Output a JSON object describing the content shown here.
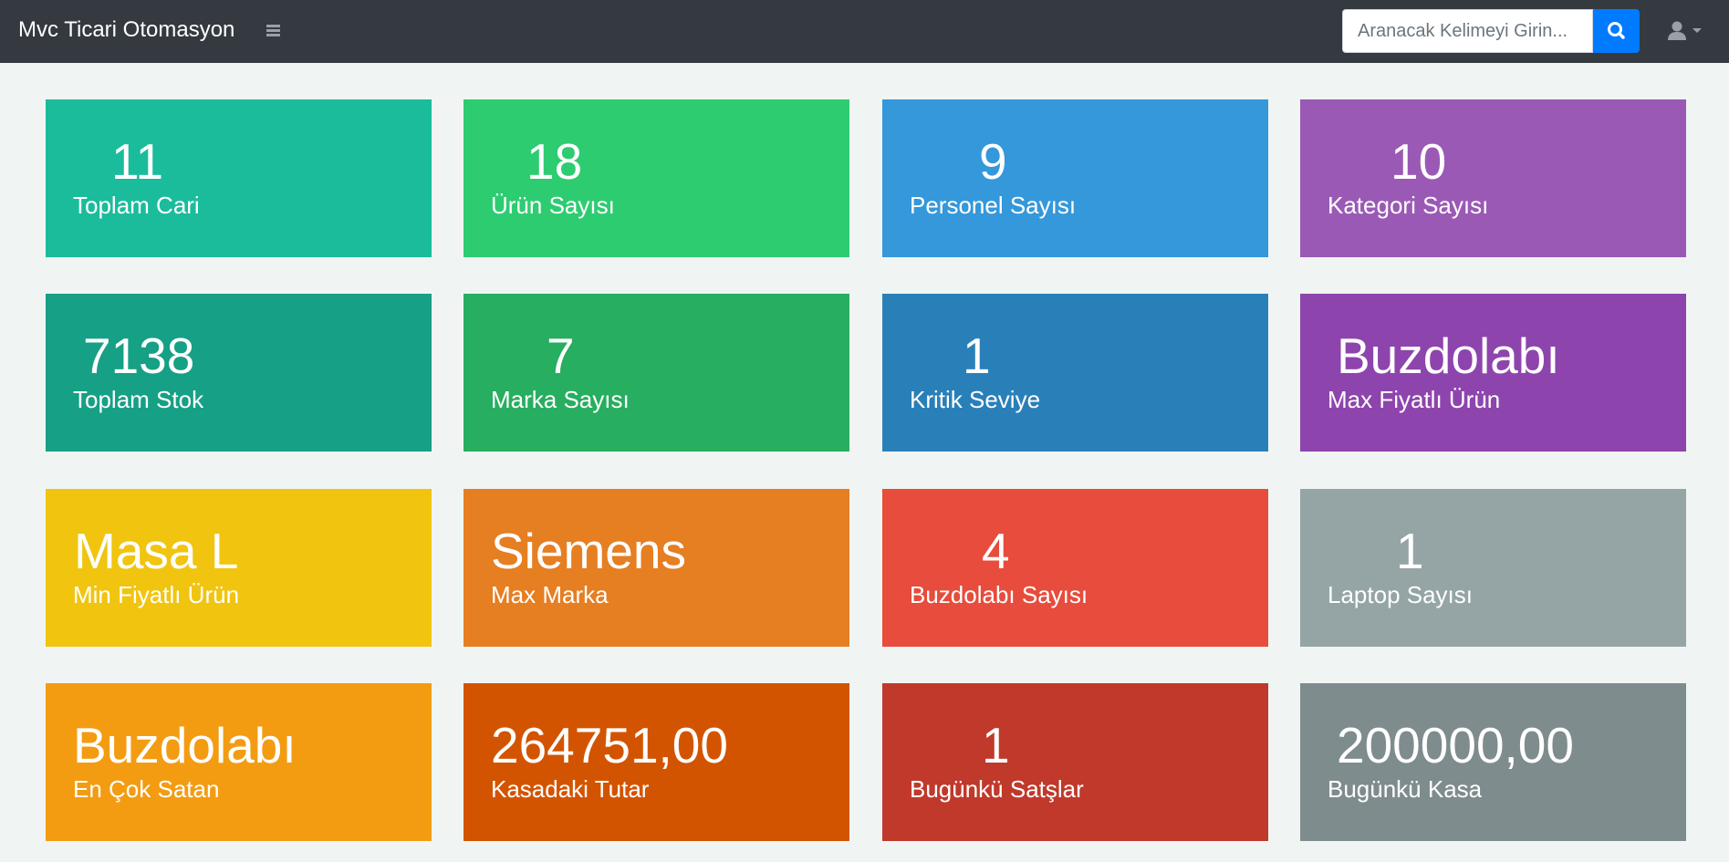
{
  "navbar": {
    "brand": "Mvc Ticari Otomasyon",
    "search_placeholder": "Aranacak Kelimeyi Girin...",
    "search_icon": "search-icon",
    "menu_icon": "hamburger-icon",
    "user_icon": "user-icon",
    "user_caret_icon": "caret-down-icon"
  },
  "tiles": [
    {
      "value": "11",
      "label": "Toplam Cari",
      "color": "#1abc9c"
    },
    {
      "value": "18",
      "label": "Ürün Sayısı",
      "color": "#2ecc71"
    },
    {
      "value": "9",
      "label": "Personel Sayısı",
      "color": "#3498db"
    },
    {
      "value": "10",
      "label": "Kategori Sayısı",
      "color": "#9b59b6"
    },
    {
      "value": "7138",
      "label": "Toplam Stok",
      "color": "#16a085"
    },
    {
      "value": "7",
      "label": "Marka Sayısı",
      "color": "#27ae60"
    },
    {
      "value": "1",
      "label": "Kritik Seviye",
      "color": "#2980b9"
    },
    {
      "value": "Buzdolabı",
      "label": "Max Fiyatlı Ürün",
      "color": "#8e44ad"
    },
    {
      "value": "Masa L",
      "label": "Min Fiyatlı Ürün",
      "color": "#f1c40f"
    },
    {
      "value": "Siemens",
      "label": "Max Marka",
      "color": "#e67e22"
    },
    {
      "value": "4",
      "label": "Buzdolabı Sayısı",
      "color": "#e74c3c"
    },
    {
      "value": "1",
      "label": "Laptop Sayısı",
      "color": "#95a5a6"
    },
    {
      "value": "Buzdolabı",
      "label": "En Çok Satan",
      "color": "#f39c12"
    },
    {
      "value": "264751,00",
      "label": "Kasadaki Tutar",
      "color": "#d35400"
    },
    {
      "value": "1",
      "label": "Bugünkü Satşlar",
      "color": "#c0392b"
    },
    {
      "value": "200000,00",
      "label": "Bugünkü Kasa",
      "color": "#7f8c8d"
    }
  ]
}
